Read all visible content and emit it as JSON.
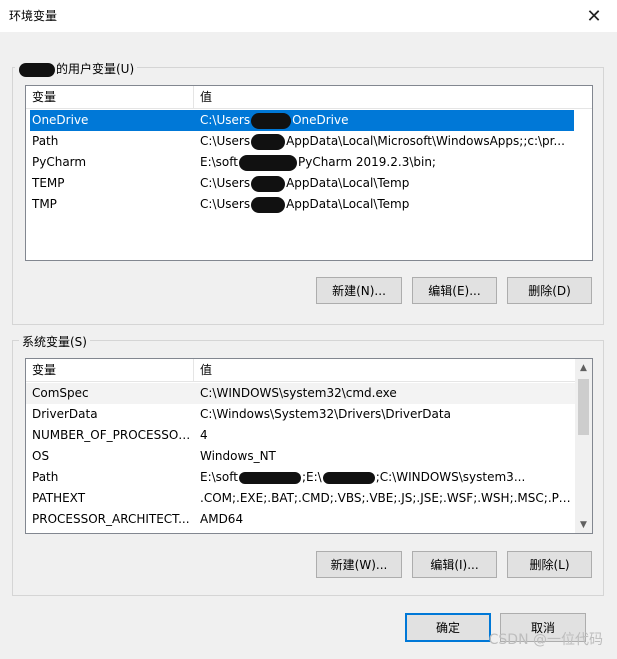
{
  "window": {
    "title": "环境变量",
    "close_glyph": "✕"
  },
  "user_group": {
    "label_suffix": "的用户变量(U)",
    "columns": [
      "变量",
      "值"
    ],
    "rows": [
      {
        "name": "OneDrive",
        "value_pre": "C:\\Users",
        "value_post": "OneDrive",
        "selected": true
      },
      {
        "name": "Path",
        "value_pre": "C:\\Users",
        "value_post": "AppData\\Local\\Microsoft\\WindowsApps;;c:\\pr..."
      },
      {
        "name": "PyCharm",
        "value_pre": "E:\\soft",
        "value_post": "PyCharm 2019.2.3\\bin;"
      },
      {
        "name": "TEMP",
        "value_pre": "C:\\Users",
        "value_post": "AppData\\Local\\Temp"
      },
      {
        "name": "TMP",
        "value_pre": "C:\\Users",
        "value_post": "AppData\\Local\\Temp"
      }
    ],
    "buttons": {
      "new": "新建(N)...",
      "edit": "编辑(E)...",
      "delete": "删除(D)"
    }
  },
  "system_group": {
    "label": "系统变量(S)",
    "columns": [
      "变量",
      "值"
    ],
    "rows": [
      {
        "name": "ComSpec",
        "value": "C:\\WINDOWS\\system32\\cmd.exe"
      },
      {
        "name": "DriverData",
        "value": "C:\\Windows\\System32\\Drivers\\DriverData"
      },
      {
        "name": "NUMBER_OF_PROCESSORS",
        "value": "4"
      },
      {
        "name": "OS",
        "value": "Windows_NT"
      },
      {
        "name": "Path",
        "value_pre": "E:\\soft",
        "value_mid": ";E:\\",
        "value_post": ";C:\\WINDOWS\\system3..."
      },
      {
        "name": "PATHEXT",
        "value": ".COM;.EXE;.BAT;.CMD;.VBS;.VBE;.JS;.JSE;.WSF;.WSH;.MSC;.PY;.P..."
      },
      {
        "name": "PROCESSOR_ARCHITECT...",
        "value": "AMD64"
      }
    ],
    "buttons": {
      "new": "新建(W)...",
      "edit": "编辑(I)...",
      "delete": "删除(L)"
    }
  },
  "footer": {
    "ok": "确定",
    "cancel": "取消",
    "watermark": "CSDN @一位代码"
  },
  "colors": {
    "accent": "#0078d7",
    "selection_text": "#ffffff"
  }
}
